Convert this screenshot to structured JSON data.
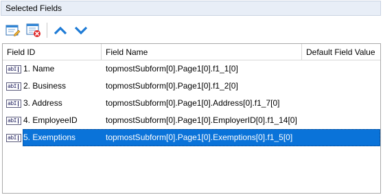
{
  "panel": {
    "title": "Selected Fields"
  },
  "toolbar": {
    "buttons": [
      {
        "name": "edit-field-button",
        "icon": "edit-form-icon"
      },
      {
        "name": "remove-field-button",
        "icon": "remove-form-icon"
      },
      {
        "name": "move-up-button",
        "icon": "chevron-up-icon"
      },
      {
        "name": "move-down-button",
        "icon": "chevron-down-icon"
      }
    ]
  },
  "grid": {
    "columns": [
      "Field ID",
      "Field Name",
      "Default Field Value"
    ],
    "rows": [
      {
        "id": "1. Name",
        "name": "topmostSubform[0].Page1[0].f1_1[0]",
        "default": ""
      },
      {
        "id": "2. Business",
        "name": "topmostSubform[0].Page1[0].f1_2[0]",
        "default": ""
      },
      {
        "id": "3. Address",
        "name": "topmostSubform[0].Page1[0].Address[0].f1_7[0]",
        "default": ""
      },
      {
        "id": "4. EmployeeID",
        "name": "topmostSubform[0].Page1[0].EmployerID[0].f1_14[0]",
        "default": ""
      },
      {
        "id": "5. Exemptions",
        "name": "topmostSubform[0].Page1[0].Exemptions[0].f1_5[0]",
        "default": ""
      }
    ],
    "selected_index": 4,
    "row_icon_text": "abI"
  },
  "colors": {
    "accent": "#1e7bd6",
    "selection": "#0a73d9",
    "header_bg": "#e8eef7"
  }
}
